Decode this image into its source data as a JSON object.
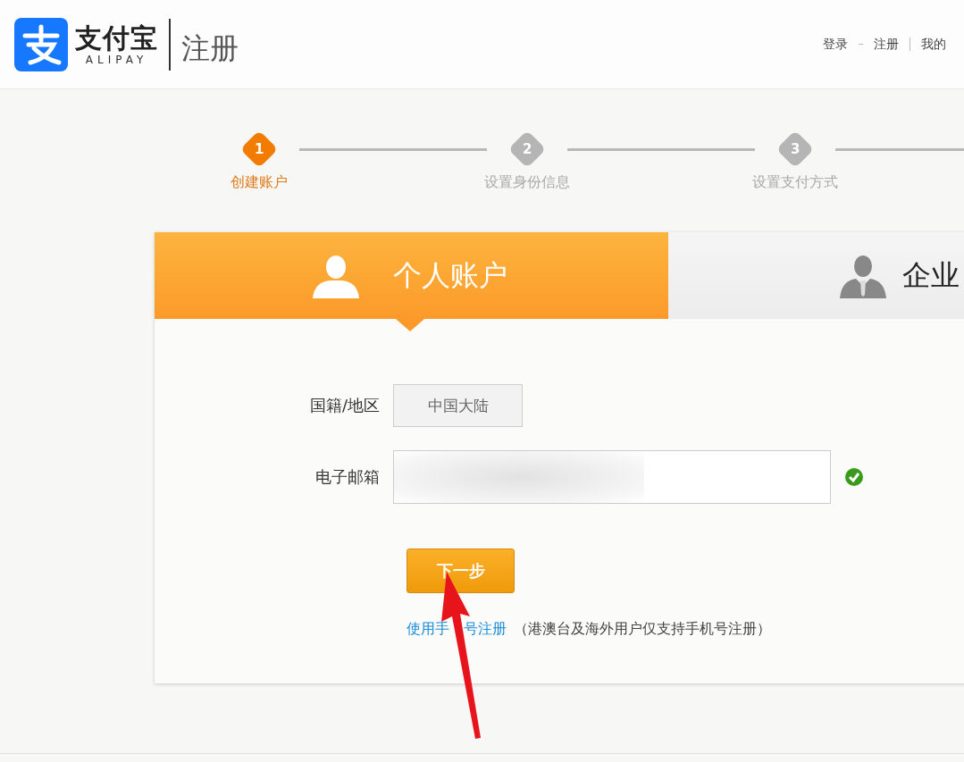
{
  "header": {
    "logo_text": "支付宝",
    "logo_sub": "ALIPAY",
    "page_title": "注册",
    "links": [
      {
        "label": "登录"
      },
      {
        "label": "注册"
      },
      {
        "label": "我的"
      }
    ]
  },
  "steps": [
    {
      "number": "1",
      "label": "创建账户",
      "selected": true
    },
    {
      "number": "2",
      "label": "设置身份信息",
      "selected": false
    },
    {
      "number": "3",
      "label": "设置支付方式",
      "selected": false
    }
  ],
  "account_tabs": [
    {
      "label": "个人账户",
      "kind": "personal",
      "selected": true
    },
    {
      "label": "企业",
      "kind": "business",
      "selected": false
    }
  ],
  "form": {
    "fields": [
      {
        "label": "国籍/地区",
        "kind": "select",
        "value": "中国大陆"
      },
      {
        "label": "电子邮箱",
        "kind": "email",
        "valid": true
      }
    ],
    "submit": "下一步",
    "alt_link": "使用手　号注册",
    "note": "（港澳台及海外用户仅支持手机号注册）"
  }
}
